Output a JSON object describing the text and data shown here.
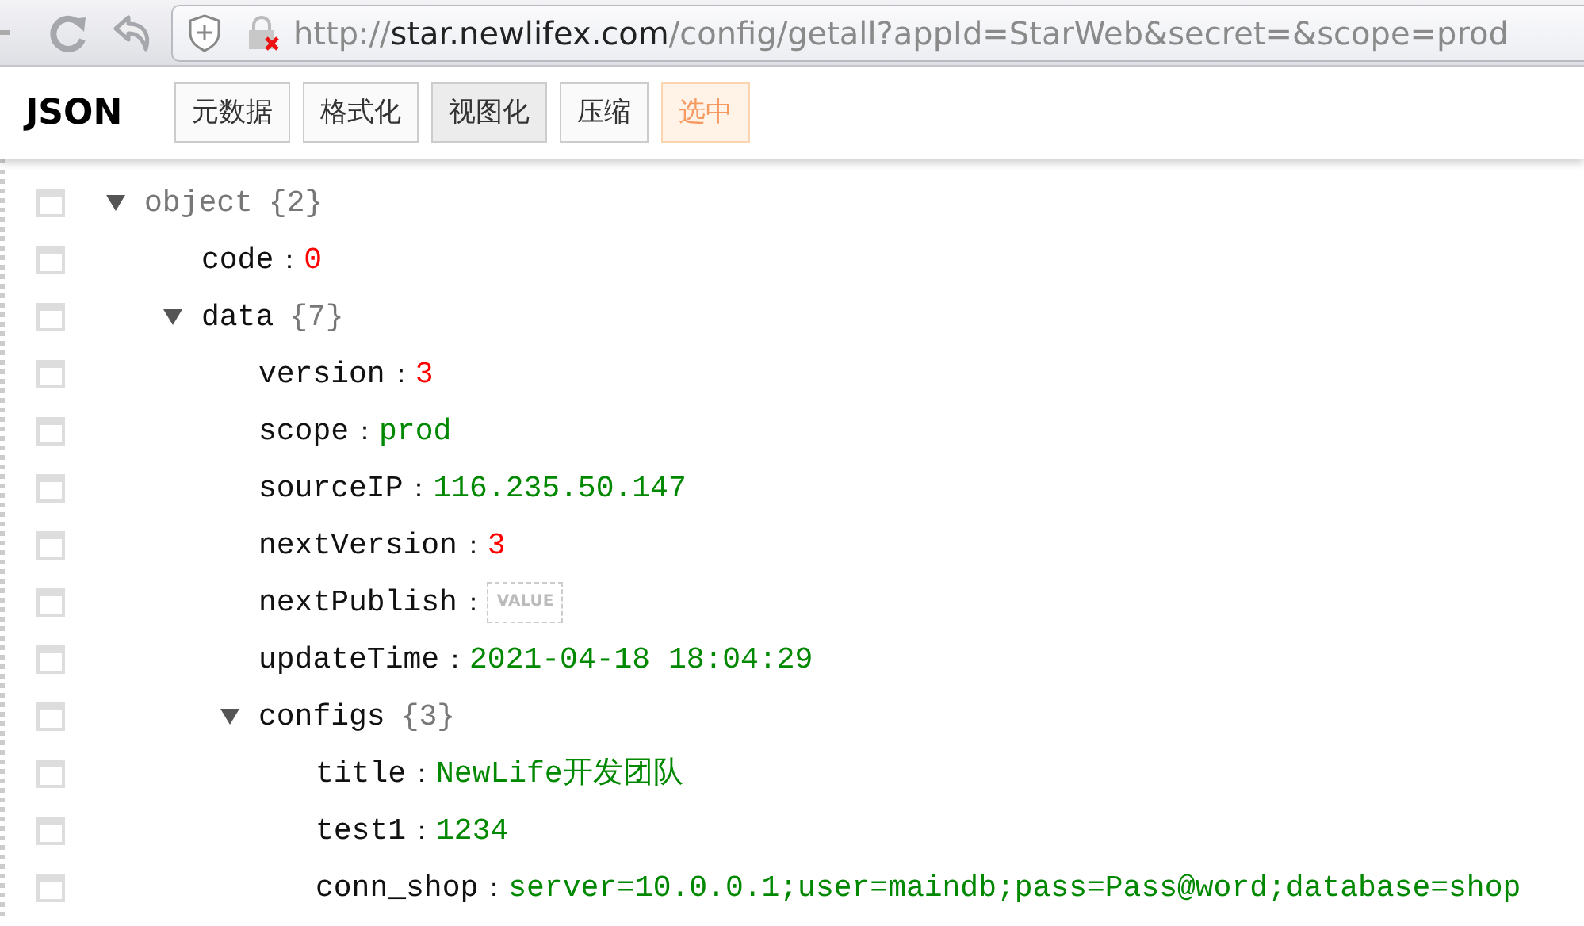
{
  "browser": {
    "url": {
      "scheme": "http://",
      "host": "star.newlifex.com",
      "path": "/config/getall?appId=StarWeb&secret=&scope=prod"
    }
  },
  "toolbar": {
    "title": "JSON",
    "buttons": [
      {
        "label": "元数据",
        "selected": false,
        "kind": "normal"
      },
      {
        "label": "格式化",
        "selected": false,
        "kind": "normal"
      },
      {
        "label": "视图化",
        "selected": true,
        "kind": "normal"
      },
      {
        "label": "压缩",
        "selected": false,
        "kind": "normal"
      },
      {
        "label": "选中",
        "selected": false,
        "kind": "accent"
      }
    ]
  },
  "tree": {
    "key": "object",
    "kind": "root",
    "count": "{2}",
    "expanded": true,
    "checked": false,
    "children": [
      {
        "key": "code",
        "colon": "：",
        "kind": "number",
        "value": "0",
        "checked": false
      },
      {
        "key": "data",
        "kind": "object",
        "count": "{7}",
        "expanded": true,
        "checked": false,
        "children": [
          {
            "key": "version",
            "colon": "：",
            "kind": "number",
            "value": "3",
            "checked": false
          },
          {
            "key": "scope",
            "colon": "：",
            "kind": "string",
            "value": "prod",
            "checked": false
          },
          {
            "key": "sourceIP",
            "colon": "：",
            "kind": "string",
            "value": "116.235.50.147",
            "checked": false
          },
          {
            "key": "nextVersion",
            "colon": "：",
            "kind": "number",
            "value": "3",
            "checked": false
          },
          {
            "key": "nextPublish",
            "colon": "：",
            "kind": "empty",
            "placeholder": "VALUE",
            "checked": false
          },
          {
            "key": "updateTime",
            "colon": "：",
            "kind": "string",
            "value": "2021-04-18 18:04:29",
            "checked": false
          },
          {
            "key": "configs",
            "kind": "object",
            "count": "{3}",
            "expanded": true,
            "checked": false,
            "children": [
              {
                "key": "title",
                "colon": "：",
                "kind": "string",
                "value": "NewLife开发团队",
                "checked": false
              },
              {
                "key": "test1",
                "colon": "：",
                "kind": "string",
                "value": "1234",
                "checked": false
              },
              {
                "key": "conn_shop",
                "colon": "：",
                "kind": "string",
                "value": "server=10.0.0.1;user=maindb;pass=Pass@word;database=shop",
                "checked": false
              }
            ]
          }
        ]
      }
    ]
  }
}
